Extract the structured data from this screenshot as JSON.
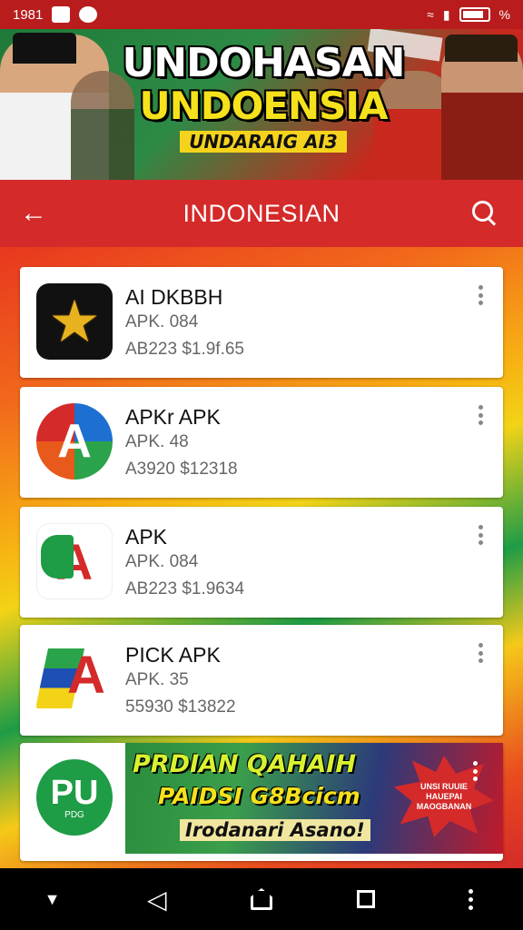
{
  "status_bar": {
    "time": "1981",
    "battery_label": "%"
  },
  "banner": {
    "title_line1": "UNDOHASAN",
    "title_line2": "UNDOENSIA",
    "subtitle": "UNDARAIG AI3"
  },
  "app_bar": {
    "title": "INDONESIAN"
  },
  "apps": [
    {
      "name": "AI DKBBH",
      "version": "APK. 084",
      "meta": "AB223  $1.9f.65"
    },
    {
      "name": "APKr APK",
      "version": "APK. 48",
      "meta": "A3920  $12318"
    },
    {
      "name": "APK",
      "version": "APK. 084",
      "meta": "AB223  $1.9634"
    },
    {
      "name": "PICK APK",
      "version": "APK. 35",
      "meta": "55930  $13822"
    }
  ],
  "promo": {
    "icon_text": "PU",
    "icon_subtext": "PDG",
    "line1": "PRDIAN QAHAIH",
    "line2": "PAIDSI G8Bcicm",
    "line3": "Irodanari Asano!",
    "burst_text": "UNSI RUUIE HAUEPAI MAOGBANAN"
  },
  "colors": {
    "status_bar": "#b81c1c",
    "app_bar": "#d42a2a",
    "card_bg": "#ffffff"
  }
}
